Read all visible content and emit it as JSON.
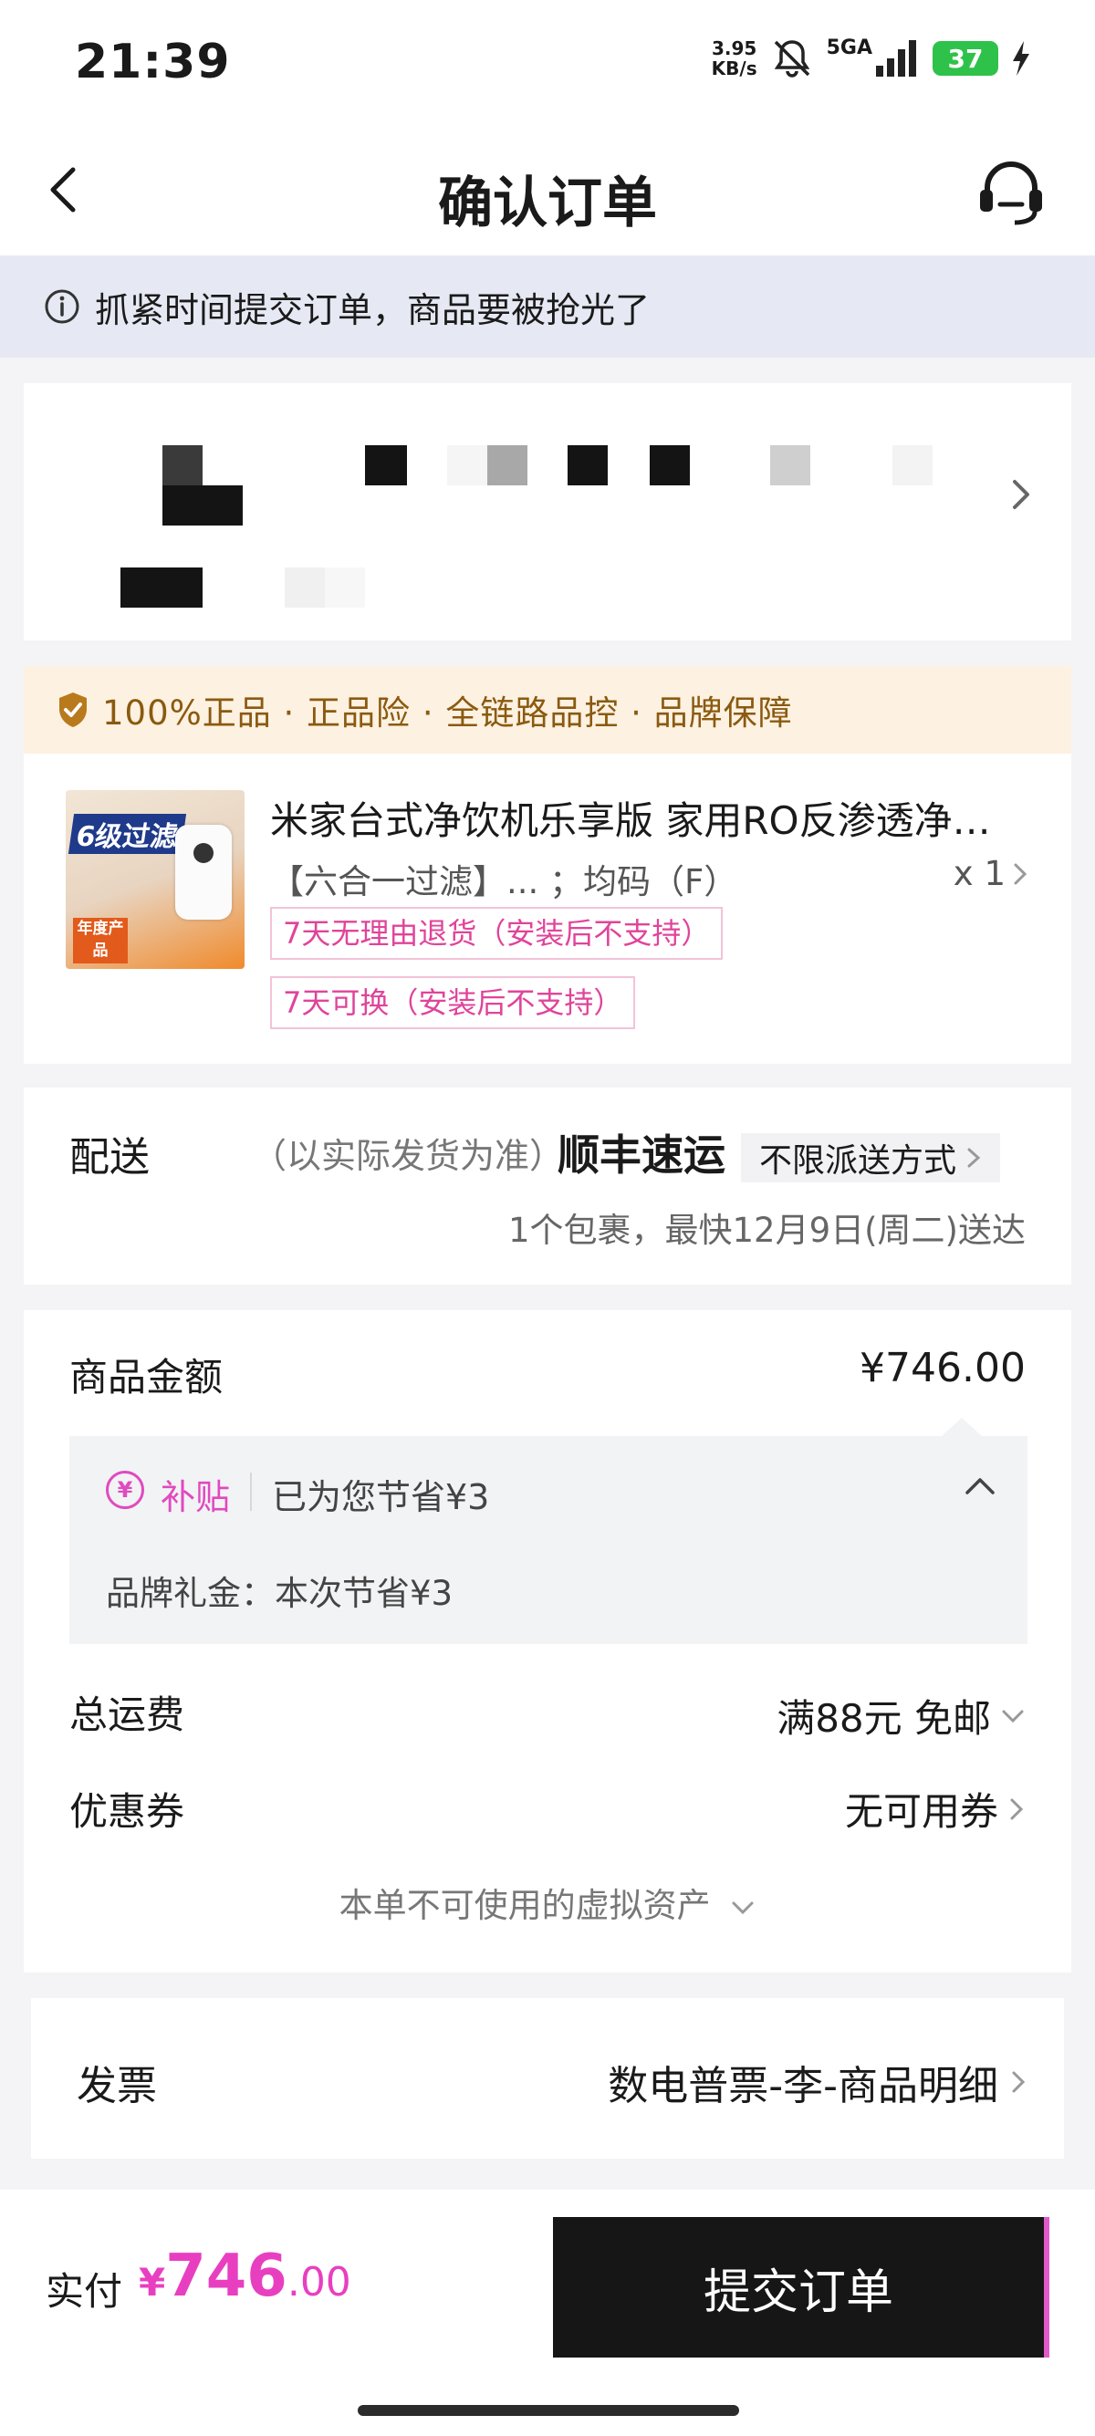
{
  "status_bar": {
    "time": "21:39",
    "net_speed_value": "3.95",
    "net_speed_unit": "KB/s",
    "signal_label": "5GA",
    "battery": "37"
  },
  "nav": {
    "title": "确认订单",
    "back_icon": "chevron-left-icon",
    "service_icon": "headset-icon"
  },
  "notice": {
    "text": "抓紧时间提交订单，商品要被抢光了",
    "icon": "info-icon"
  },
  "guarantee": {
    "text": "100%正品 · 正品险 · 全链路品控 · 品牌保障",
    "icon": "shield-check-icon"
  },
  "product": {
    "name": "米家台式净饮机乐享版 家用RO反渗透净水器",
    "spec": "【六合一过滤】... ；均码（F）",
    "qty": "x 1",
    "policies": [
      "7天无理由退货（安装后不支持）",
      "7天可换（安装后不支持）"
    ],
    "image": {
      "tag": "6级过滤",
      "badge": "年度产品"
    }
  },
  "delivery": {
    "label": "配送",
    "note": "（以实际发货为准）",
    "carrier": "顺丰速运",
    "method": "不限派送方式",
    "eta": "1个包裹，最快12月9日(周二)送达"
  },
  "amount": {
    "goods_label": "商品金额",
    "goods_value": "¥746.00",
    "subsidy": {
      "icon_glyph": "¥",
      "tag": "补贴",
      "saved": "已为您节省¥3",
      "brand": "品牌礼金：本次节省¥3"
    },
    "shipping_label": "总运费",
    "shipping_value": "满88元 免邮",
    "coupon_label": "优惠券",
    "coupon_value": "无可用券",
    "virtual_assets": "本单不可使用的虚拟资产"
  },
  "invoice": {
    "label": "发票",
    "value": "数电普票-李-商品明细"
  },
  "bottom": {
    "pay_label": "实付",
    "currency": "¥",
    "amount_int": "746",
    "amount_dec": ".00",
    "submit": "提交订单"
  },
  "colors": {
    "accent": "#e83fc1",
    "notice_bg": "#e6e9f3",
    "guarantee_bg": "#fdf1e1",
    "guarantee_text": "#8a5a10",
    "button_bg": "#161616"
  }
}
